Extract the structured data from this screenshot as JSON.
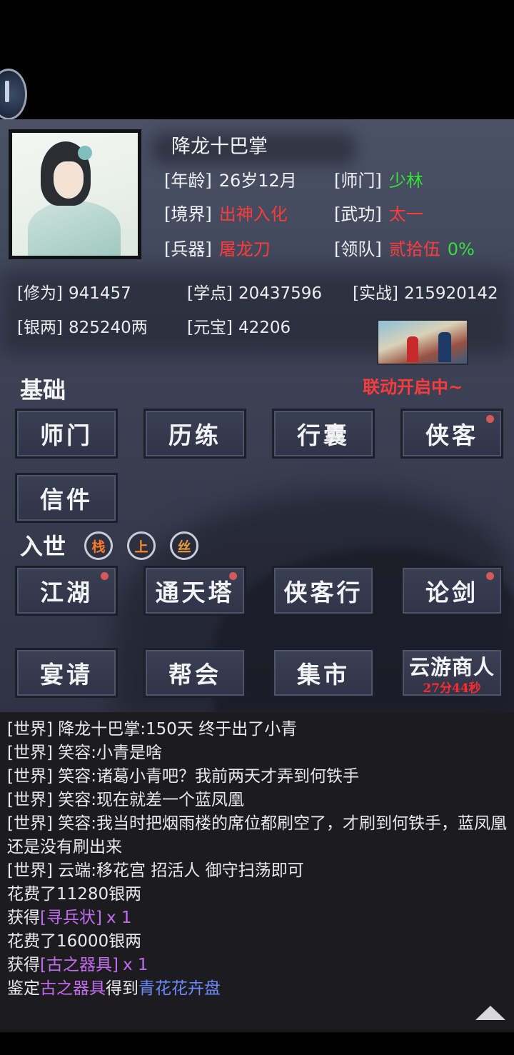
{
  "profile": {
    "name": "降龙十巴掌",
    "age_label": "[年龄]",
    "age": "26岁12月",
    "sect_label": "[师门]",
    "sect": "少林",
    "realm_label": "[境界]",
    "realm": "出神入化",
    "martial_label": "[武功]",
    "martial": "太一",
    "weapon_label": "[兵器]",
    "weapon": "屠龙刀",
    "team_label": "[领队]",
    "team": "贰拾伍",
    "team_pct": "0%"
  },
  "stats": {
    "cultivation_label": "[修为]",
    "cultivation": "941457",
    "points_label": "[学点]",
    "points": "20437596",
    "combat_label": "[实战]",
    "combat": "215920142",
    "silver_label": "[银两]",
    "silver": "825240两",
    "ingot_label": "[元宝]",
    "ingot": "42206"
  },
  "sections": {
    "basic": "基础",
    "promo": "联动开启中~",
    "world": "入世",
    "world_icons": [
      "栈",
      "上",
      "丝"
    ]
  },
  "buttons": {
    "basic": [
      "师门",
      "历练",
      "行囊",
      "侠客",
      "信件"
    ],
    "world": [
      "江湖",
      "通天塔",
      "侠客行",
      "论剑",
      "宴请",
      "帮会",
      "集市",
      "云游商人"
    ],
    "merchant_timer": "27分44秒"
  },
  "chat": {
    "lines": [
      "[世界] 降龙十巴掌:150天 终于出了小青",
      "[世界] 笑容:小青是啥",
      "[世界] 笑容:诸葛小青吧？我前两天才弄到何铁手",
      "[世界] 笑容:现在就差一个蓝凤凰",
      "[世界] 笑容:我当时把烟雨楼的席位都刷空了，才刷到何铁手，蓝凤凰还是没有刷出来",
      "[世界] 云端:移花宫 招活人 御守扫荡即可",
      "花费了11280银两"
    ],
    "gain1_prefix": "获得",
    "gain1_item": "[寻兵状]",
    "gain1_count": "x 1",
    "spend2": "花费了16000银两",
    "gain2_prefix": "获得",
    "gain2_item": "[古之器具]",
    "gain2_count": "x 1",
    "appraise_prefix": "鉴定",
    "appraise_item": "古之器具",
    "appraise_mid": "得到",
    "appraise_result": "青花花卉盘"
  },
  "colors": {
    "red": "#ff3a3a",
    "green": "#35e03c",
    "purple": "#c36bf0",
    "blue": "#6c88ff"
  }
}
